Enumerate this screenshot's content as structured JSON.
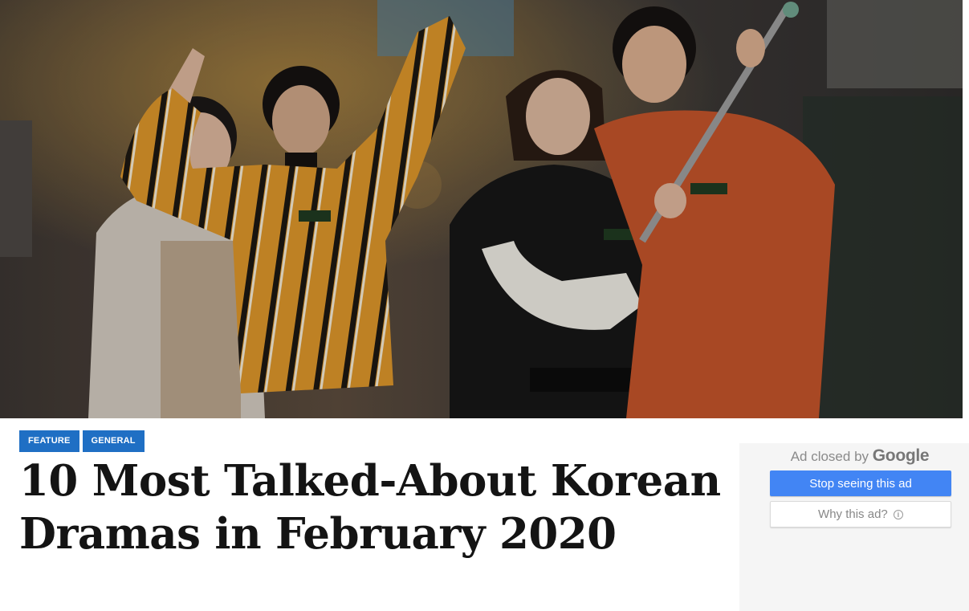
{
  "hero": {
    "image_description_icon": "drama-still-photo",
    "name_tag_text": "···"
  },
  "tags": [
    {
      "label": "FEATURE"
    },
    {
      "label": "GENERAL"
    }
  ],
  "article": {
    "title": "10 Most Talked-About Korean Dramas in February 2020"
  },
  "ad": {
    "closed_prefix": "Ad closed by",
    "brand": "Google",
    "stop_label": "Stop seeing this ad",
    "why_label": "Why this ad?",
    "info_icon": "ⓘ"
  },
  "colors": {
    "tag_bg": "#1f6fc4",
    "stop_button_bg": "#4285f4",
    "headline": "#141414",
    "ad_panel_bg": "#f5f5f5"
  }
}
